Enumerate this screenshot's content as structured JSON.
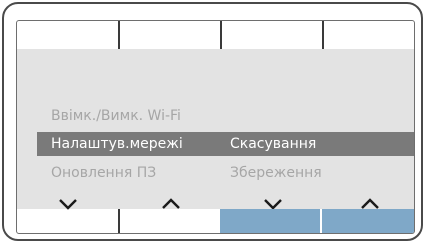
{
  "menu": {
    "rows": [
      {
        "left": "Ввімк./Вимк. Wi-Fi",
        "right": ""
      },
      {
        "left": "Налаштув.мережі",
        "right": "Скасування"
      },
      {
        "left": "Оновлення ПЗ",
        "right": "Збереження"
      }
    ]
  },
  "softkeys": {
    "arrows": [
      "chevron-down-icon",
      "chevron-up-icon",
      "chevron-down-icon",
      "chevron-up-icon"
    ],
    "bottom_active": [
      false,
      false,
      true,
      true
    ]
  },
  "colors": {
    "selected_row": "#7a7a7a",
    "menu_background": "#e3e3e3",
    "active_softkey": "#7fa8c8",
    "dim_text": "#a6a6a6"
  }
}
